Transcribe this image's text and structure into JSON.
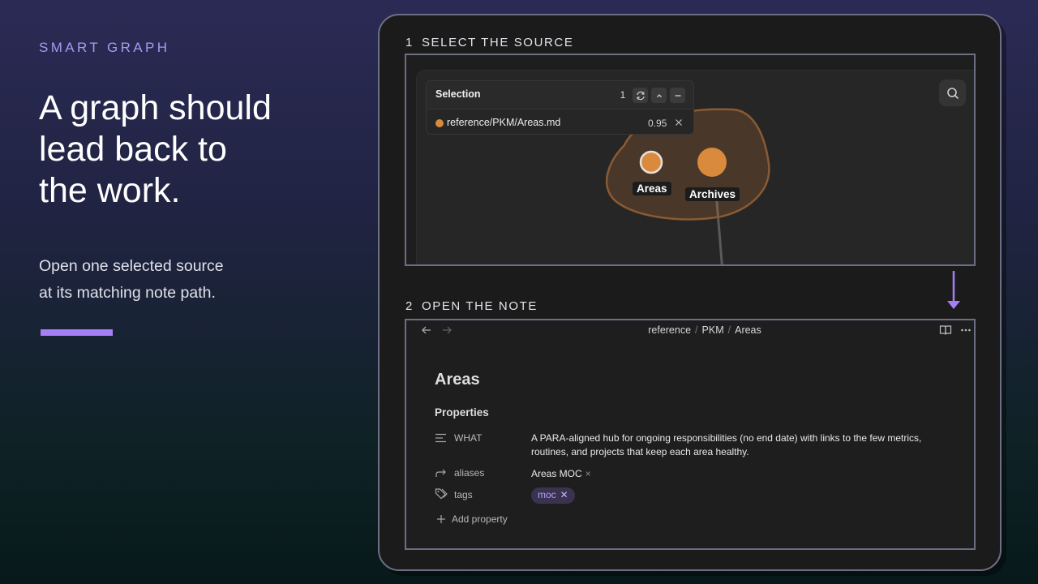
{
  "left": {
    "eyebrow": "SMART GRAPH",
    "headline_lines": [
      "A graph should",
      "lead back to",
      "the work."
    ],
    "sub_lines": [
      "Open one selected source",
      "at its matching note path."
    ],
    "accent_color": "#a47ff5"
  },
  "steps": {
    "step1": {
      "num": "1",
      "label": "SELECT THE SOURCE"
    },
    "step2": {
      "num": "2",
      "label": "OPEN THE NOTE"
    }
  },
  "graph": {
    "selection": {
      "title": "Selection",
      "count": "1",
      "item_path": "reference/PKM/Areas.md",
      "item_score": "0.95"
    },
    "nodes": [
      {
        "label": "Areas",
        "color": "#d98a3d",
        "selected": true
      },
      {
        "label": "Archives",
        "color": "#d98a3d",
        "selected": false
      }
    ],
    "cluster_color": "#c97a3a",
    "search_icon": "search-icon"
  },
  "note": {
    "breadcrumb": [
      "reference",
      "PKM",
      "Areas"
    ],
    "title": "Areas",
    "properties_title": "Properties",
    "properties": {
      "what": {
        "key": "WHAT",
        "value": "A PARA-aligned hub for ongoing responsibilities (no end date) with links to the few metrics, routines, and projects that keep each area healthy."
      },
      "aliases": {
        "key": "aliases",
        "value": "Areas MOC"
      },
      "tags": {
        "key": "tags",
        "value": "moc"
      }
    },
    "add_property": "Add property",
    "tag_color": "#b69dff"
  }
}
